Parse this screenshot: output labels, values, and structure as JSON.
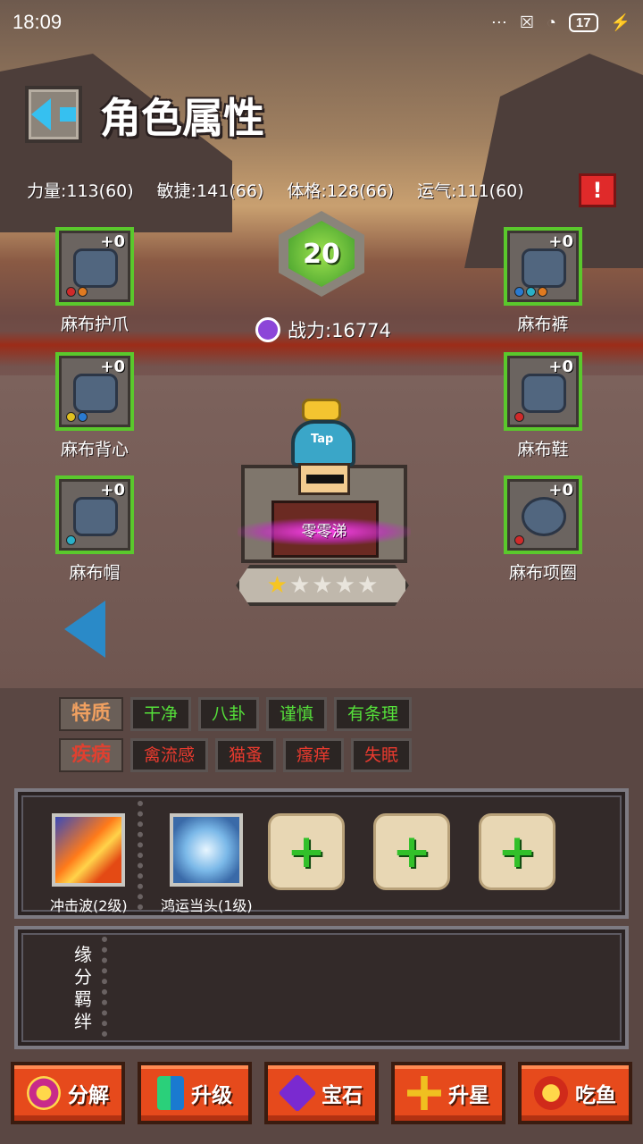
{
  "status_bar": {
    "time": "18:09",
    "battery": "17"
  },
  "header": {
    "title": "角色属性"
  },
  "attributes": [
    {
      "label": "力量:113(60)"
    },
    {
      "label": "敏捷:141(66)"
    },
    {
      "label": "体格:128(66)"
    },
    {
      "label": "运气:111(60)"
    }
  ],
  "alert": {
    "symbol": "!"
  },
  "equipment": {
    "left": [
      {
        "name": "麻布护爪",
        "enhance": "+0"
      },
      {
        "name": "麻布背心",
        "enhance": "+0"
      },
      {
        "name": "麻布帽",
        "enhance": "+0"
      }
    ],
    "right": [
      {
        "name": "麻布裤",
        "enhance": "+0"
      },
      {
        "name": "麻布鞋",
        "enhance": "+0"
      },
      {
        "name": "麻布项圈",
        "enhance": "+0"
      }
    ]
  },
  "hero": {
    "level": "20",
    "power_label": "战力:16774",
    "name": "零零涕",
    "hat_text": "Tap",
    "stars_filled": 1,
    "stars_total": 5
  },
  "traits": {
    "positive_label": "特质",
    "positive": [
      "干净",
      "八卦",
      "谨慎",
      "有条理"
    ],
    "negative_label": "疾病",
    "negative": [
      "禽流感",
      "猫蚤",
      "瘙痒",
      "失眠"
    ]
  },
  "skills": [
    {
      "name": "冲击波(2级)"
    },
    {
      "name": "鸿运当头(1级)"
    }
  ],
  "skill_add_symbol": "+",
  "fate": {
    "label": "缘分羁绊"
  },
  "actions": [
    {
      "label": "分解",
      "icon": "decompose-icon",
      "color": "#e0301e"
    },
    {
      "label": "升级",
      "icon": "upgrade-icon",
      "color": "#1fa05a"
    },
    {
      "label": "宝石",
      "icon": "gem-icon",
      "color": "#7a2ad0"
    },
    {
      "label": "升星",
      "icon": "star-up-icon",
      "color": "#e8b42a"
    },
    {
      "label": "吃鱼",
      "icon": "fish-icon",
      "color": "#e0301e"
    }
  ]
}
